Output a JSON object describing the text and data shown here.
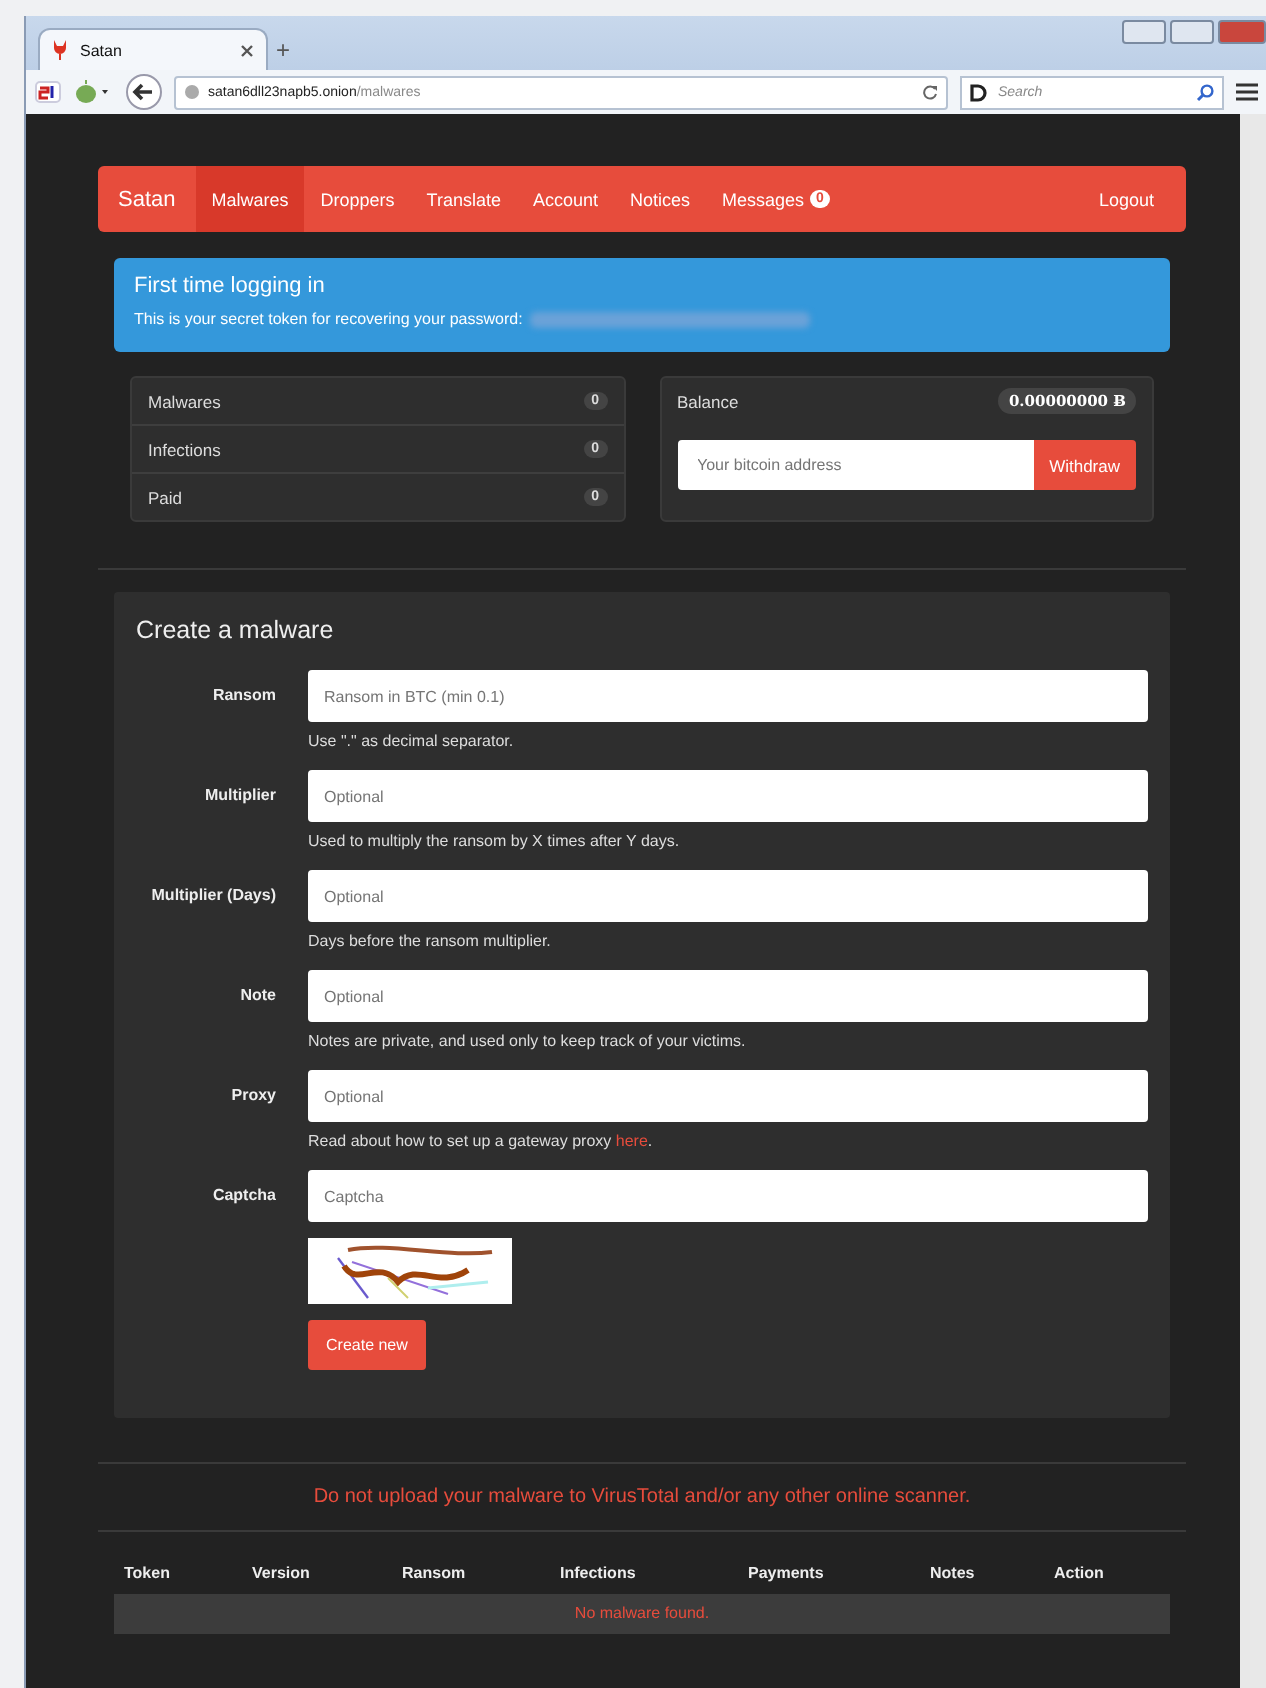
{
  "browser": {
    "tab_title": "Satan",
    "new_tab": "+",
    "url_host": "satan6dll23napb5.onion",
    "url_path": "/malwares",
    "search_placeholder": "Search"
  },
  "navbar": {
    "brand": "Satan",
    "items": [
      {
        "label": "Malwares",
        "selected": true
      },
      {
        "label": "Droppers",
        "selected": false
      },
      {
        "label": "Translate",
        "selected": false
      },
      {
        "label": "Account",
        "selected": false
      },
      {
        "label": "Notices",
        "selected": false
      },
      {
        "label": "Messages",
        "selected": false,
        "badge": "0"
      }
    ],
    "logout": "Logout"
  },
  "alert": {
    "title": "First time logging in",
    "text": "This is your secret token for recovering your password:"
  },
  "stats": [
    {
      "label": "Malwares",
      "count": "0"
    },
    {
      "label": "Infections",
      "count": "0"
    },
    {
      "label": "Paid",
      "count": "0"
    }
  ],
  "balance": {
    "label": "Balance",
    "amount": "0.00000000",
    "currency": "Ƀ",
    "placeholder": "Your bitcoin address",
    "button": "Withdraw"
  },
  "form": {
    "title": "Create a malware",
    "fields": [
      {
        "label": "Ransom",
        "placeholder": "Ransom in BTC (min 0.1)",
        "help": "Use \".\" as decimal separator."
      },
      {
        "label": "Multiplier",
        "placeholder": "Optional",
        "help": "Used to multiply the ransom by X times after Y days."
      },
      {
        "label": "Multiplier (Days)",
        "placeholder": "Optional",
        "help": "Days before the ransom multiplier."
      },
      {
        "label": "Note",
        "placeholder": "Optional",
        "help": "Notes are private, and used only to keep track of your victims."
      },
      {
        "label": "Proxy",
        "placeholder": "Optional",
        "help": "Read about how to set up a gateway proxy",
        "help_link": "here",
        "help_end": "."
      },
      {
        "label": "Captcha",
        "placeholder": "Captcha",
        "kind": "captcha"
      }
    ],
    "submit": "Create new"
  },
  "warning": "Do not upload your malware to VirusTotal and/or any other online scanner.",
  "table": {
    "columns": [
      "Token",
      "Version",
      "Ransom",
      "Infections",
      "Payments",
      "Notes",
      "Action"
    ],
    "empty": "No malware found."
  }
}
